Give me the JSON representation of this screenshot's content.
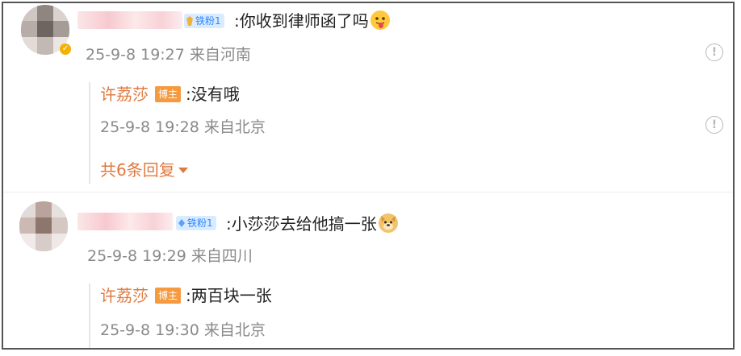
{
  "comments": [
    {
      "fan_badge": "铁粉1",
      "text": ":你收到律师函了吗",
      "meta": "25-9-8 19:27 来自河南",
      "report_icon": "!",
      "reply": {
        "name": "许荔莎",
        "badge": "博主",
        "text": ":没有哦",
        "meta": "25-9-8 19:28 来自北京",
        "report_icon": "!"
      },
      "more_replies": "共6条回复"
    },
    {
      "fan_badge": "铁粉1",
      "text": ":小莎莎去给他搞一张",
      "meta": "25-9-8 19:29 来自四川",
      "reply": {
        "name": "许荔莎",
        "badge": "博主",
        "text": ":两百块一张",
        "meta": "25-9-8 19:30 来自北京"
      }
    }
  ],
  "colors": {
    "accent_orange": "#e07a3f",
    "host_badge": "#f59a3e",
    "fan_badge_bg": "#d9ecff",
    "fan_badge_text": "#2f86ff",
    "meta_gray": "#8a8a8a"
  },
  "icons": {
    "emoji1": "tongue-face-emoji",
    "emoji2": "doge-emoji",
    "report": "report-exclamation-icon",
    "expand": "caret-down-icon",
    "verified": "verified-badge-icon"
  }
}
